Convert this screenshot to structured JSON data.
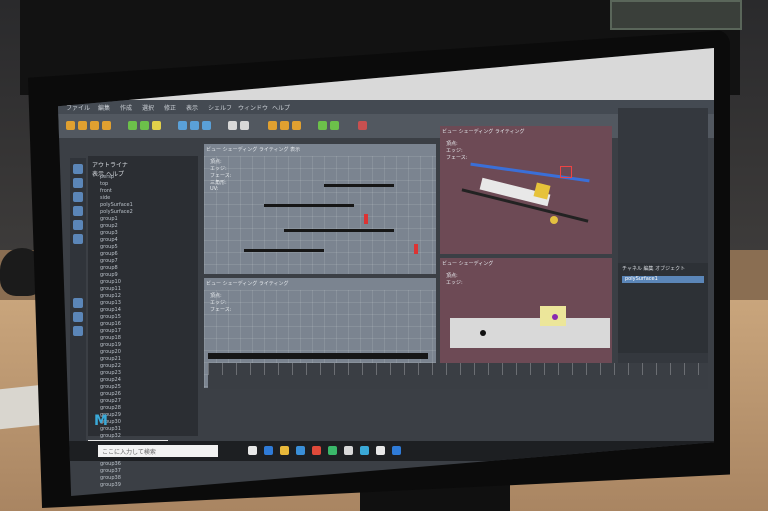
{
  "maya_window": {
    "menu_items": [
      "ファイル",
      "編集",
      "作成",
      "選択",
      "修正",
      "表示",
      "シェルフ",
      "ウィンドウ",
      "ヘルプ"
    ],
    "outliner": {
      "title": "アウトライナ",
      "menu": [
        "表示",
        "ヘルプ"
      ],
      "items": [
        "persp",
        "top",
        "front",
        "side",
        "polySurface1",
        "polySurface2",
        "group1",
        "group2",
        "group3",
        "group4",
        "group5",
        "group6",
        "group7",
        "group8",
        "group9",
        "group10",
        "group11",
        "group12",
        "group13",
        "group14",
        "group15",
        "group16",
        "group17",
        "group18",
        "group19",
        "group20",
        "group21",
        "group22",
        "group23",
        "group24",
        "group25",
        "group26",
        "group27",
        "group28",
        "group29",
        "group30",
        "group31",
        "group32",
        "group33",
        "group34",
        "group35",
        "group36",
        "group37",
        "group38",
        "group39"
      ]
    },
    "viewport_menu": [
      "ビュー",
      "シェーディング",
      "ライティング",
      "表示",
      "レンダラ",
      "パネル"
    ],
    "hud_stats": [
      "頂点:",
      "エッジ:",
      "フェース:",
      "三角形:",
      "UV:"
    ],
    "channel_box": {
      "tabs": [
        "チャネル",
        "編集",
        "オブジェクト"
      ],
      "selected": "polySurface1"
    },
    "logo": "M"
  },
  "taskbar": {
    "search_placeholder": "ここに入力して検索"
  },
  "colors": {
    "ui_gray": "#3b3f45",
    "highlight_blue": "#5b86b8",
    "view_bg_maroon": "#6d4a55",
    "view_bg_gray": "#7b8490",
    "maya_logo": "#3aa9d8"
  }
}
